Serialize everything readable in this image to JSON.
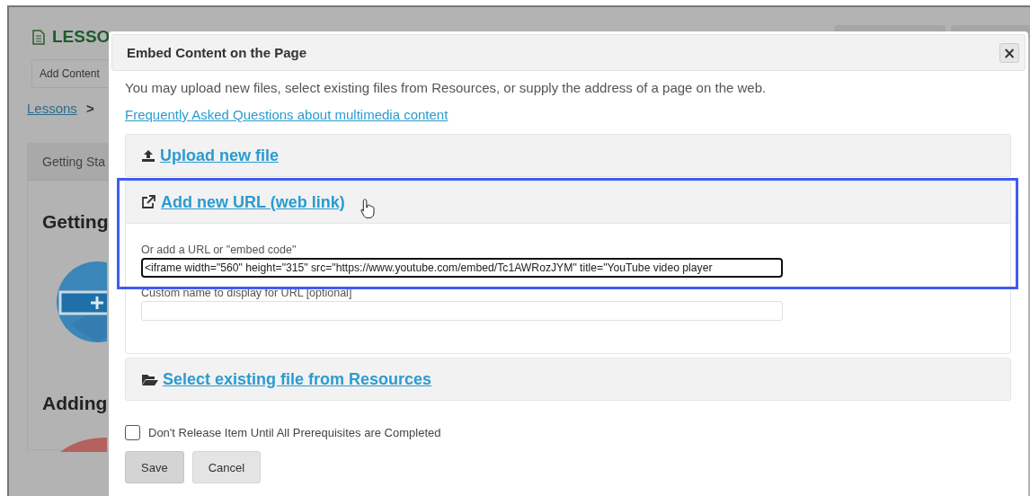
{
  "background": {
    "page_title": "LESSO",
    "add_content": "Add Content",
    "breadcrumb": [
      {
        "label": "Lessons",
        "kind": "link"
      },
      {
        "label": ">",
        "kind": "separator"
      }
    ],
    "card_tab": "Getting Sta",
    "headings": [
      "Getting",
      "Adding"
    ]
  },
  "dialog": {
    "title": "Embed Content on the Page",
    "close": "×",
    "intro": "You may upload new files, select existing files from Resources, or supply the address of a page on the web.",
    "faq_link": "Frequently Asked Questions about multimedia content",
    "sections": [
      {
        "kind": "upload",
        "label": "Upload new file",
        "expanded": false,
        "highlighted": false
      },
      {
        "kind": "url",
        "label": "Add new URL (web link)",
        "expanded": true,
        "highlighted": true,
        "url_label": "Or add a URL or \"embed code\"",
        "url_value": "<iframe width=\"560\" height=\"315\" src=\"https://www.youtube.com/embed/Tc1AWRozJYM\" title=\"YouTube video player",
        "name_label": "Custom name to display for URL [optional]"
      },
      {
        "kind": "resources",
        "label": "Select existing file from Resources",
        "expanded": false,
        "highlighted": false
      }
    ],
    "prerequisite": {
      "label": "Don't Release Item Until All Prerequisites are Completed",
      "checked": false
    },
    "buttons": [
      {
        "label": "Save",
        "kind": "primary"
      },
      {
        "label": "Cancel",
        "kind": "secondary"
      }
    ]
  }
}
